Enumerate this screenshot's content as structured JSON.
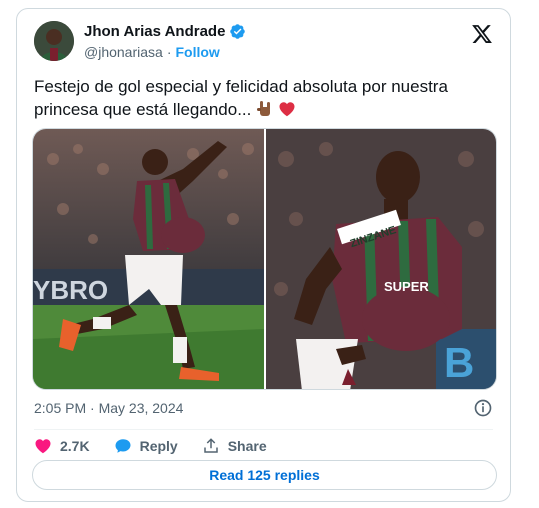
{
  "author": {
    "name": "Jhon Arias Andrade",
    "handle": "@jhonariasa",
    "follow_label": "Follow",
    "separator": "·"
  },
  "tweet": {
    "text": "Festejo de gol especial y felicidad absoluta por nuestra princesa que está llegando... ",
    "timestamp": "2:05 PM · May 23, 2024"
  },
  "actions": {
    "likes": "2.7K",
    "reply_label": "Reply",
    "share_label": "Share"
  },
  "read_replies_label": "Read 125 replies",
  "photos": {
    "jersey_text_1": "ZINZANE",
    "jersey_text_2": "SUPER",
    "board_text": "YBRO"
  },
  "colors": {
    "accent": "#1d9bf0",
    "like": "#f91880",
    "text_secondary": "#536471",
    "border": "#cfd9de",
    "jersey_green": "#6b2c3b",
    "jersey_maroon": "#7a1f2e"
  },
  "icons": [
    "verified-badge-icon",
    "x-logo-icon",
    "info-icon",
    "heart-icon",
    "reply-bubble-icon",
    "share-icon",
    "rock-hand-emoji",
    "red-heart-emoji"
  ]
}
